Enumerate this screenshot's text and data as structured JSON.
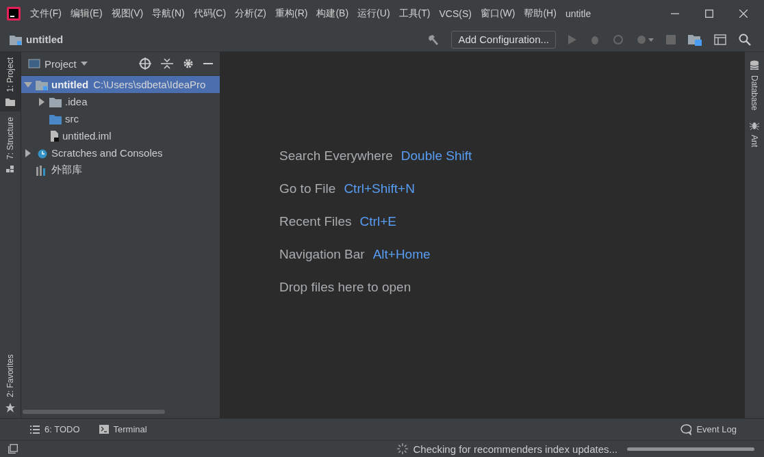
{
  "title_bar": {
    "menu": [
      "文件(F)",
      "编辑(E)",
      "视图(V)",
      "导航(N)",
      "代码(C)",
      "分析(Z)",
      "重构(R)",
      "构建(B)",
      "运行(U)",
      "工具(T)",
      "VCS(S)",
      "窗口(W)",
      "帮助(H)"
    ],
    "title": "untitle"
  },
  "navigation_bar": {
    "project": "untitled",
    "run_config": "Add Configuration..."
  },
  "left_stripe_top": [
    {
      "label": "1: Project",
      "kind": "folder",
      "selected": true
    },
    {
      "label": "7: Structure",
      "kind": "structure",
      "selected": false
    }
  ],
  "left_stripe_bottom": [
    {
      "label": "2: Favorites",
      "kind": "star",
      "selected": false
    }
  ],
  "project_panel": {
    "title": "Project",
    "tree": [
      {
        "label": "untitled",
        "path": "C:\\Users\\sdbeta\\IdeaPro",
        "kind": "module",
        "selected": true,
        "expanded": true,
        "children": [
          {
            "label": ".idea",
            "kind": "folder",
            "selected": false,
            "expanded": false
          },
          {
            "label": "src",
            "kind": "source",
            "selected": false
          },
          {
            "label": "untitled.iml",
            "kind": "file",
            "selected": false
          }
        ]
      },
      {
        "label": "Scratches and Consoles",
        "kind": "scratches",
        "selected": false,
        "expanded": false
      },
      {
        "label": "外部库",
        "kind": "library",
        "selected": false
      }
    ]
  },
  "editor_hints": [
    {
      "label": "Search Everywhere",
      "shortcut": "Double Shift"
    },
    {
      "label": "Go to File",
      "shortcut": "Ctrl+Shift+N"
    },
    {
      "label": "Recent Files",
      "shortcut": "Ctrl+E"
    },
    {
      "label": "Navigation Bar",
      "shortcut": "Alt+Home"
    },
    {
      "label": "Drop files here to open"
    }
  ],
  "right_stripe": [
    {
      "label": "Database",
      "kind": "database"
    },
    {
      "label": "Ant",
      "kind": "ant"
    }
  ],
  "bottom_tabs": [
    {
      "label": "6: TODO",
      "kind": "list"
    },
    {
      "label": "Terminal",
      "kind": "terminal"
    }
  ],
  "event_log": "Event Log",
  "status_bar": {
    "text": "Checking for recommenders index updates...",
    "level": 1
  }
}
